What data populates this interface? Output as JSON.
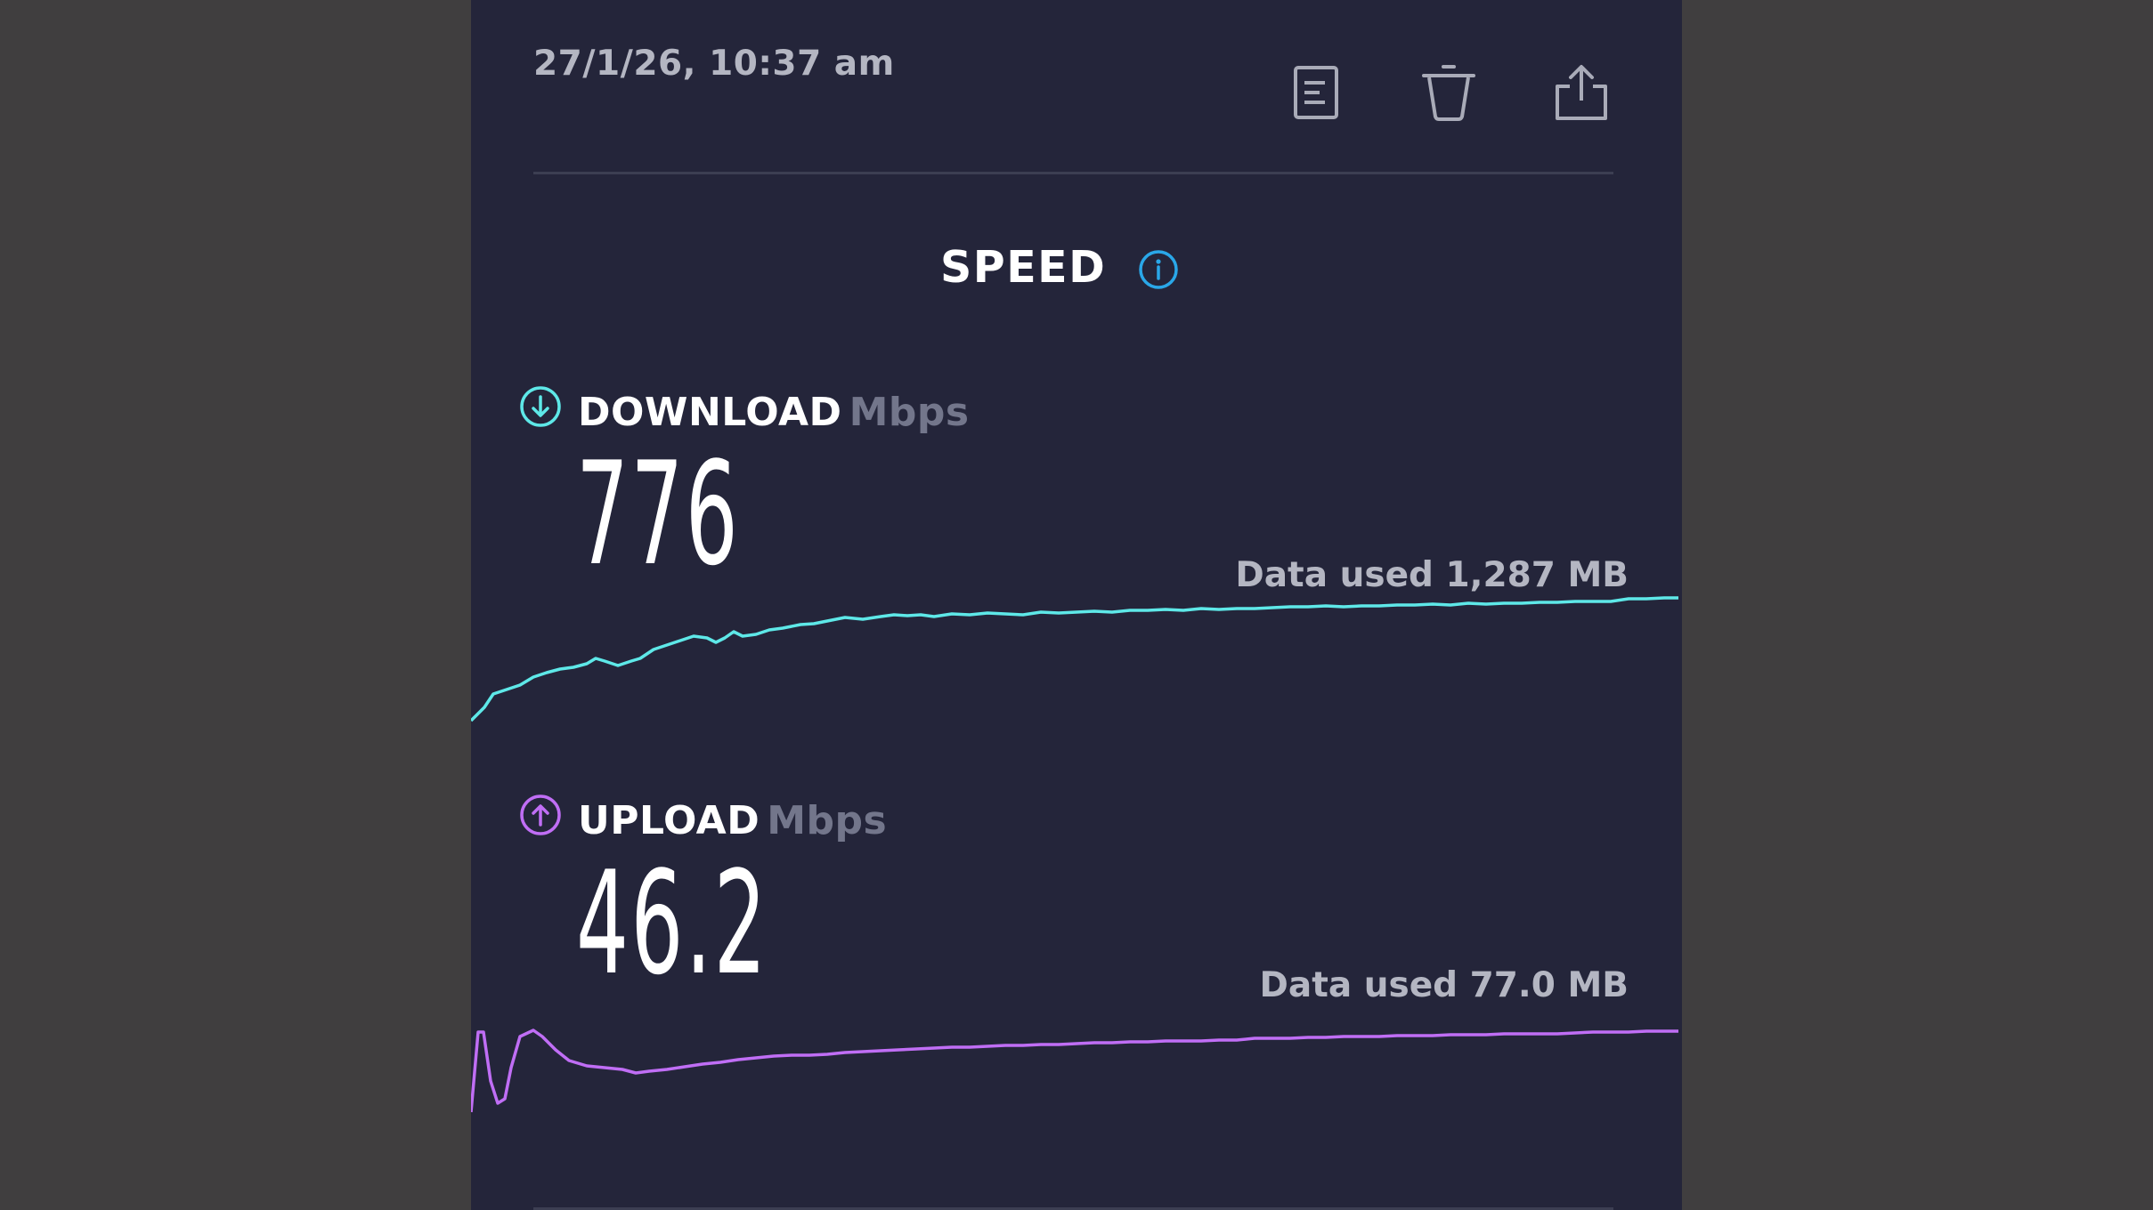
{
  "header": {
    "timestamp": "27/1/26, 10:37 am",
    "actions": [
      {
        "id": "details",
        "icon": "document-icon"
      },
      {
        "id": "delete",
        "icon": "trash-icon"
      },
      {
        "id": "share",
        "icon": "share-icon"
      }
    ]
  },
  "section": {
    "title": "SPEED",
    "info_icon": "info-icon"
  },
  "download": {
    "label": "DOWNLOAD",
    "unit": "Mbps",
    "value": "776",
    "data_used": "Data used 1,287 MB",
    "icon": "download-arrow-icon",
    "color": "#5ee8e8"
  },
  "upload": {
    "label": "UPLOAD",
    "unit": "Mbps",
    "value": "46.2",
    "data_used": "Data used 77.0 MB",
    "icon": "upload-arrow-icon",
    "color": "#c06ef5"
  },
  "colors": {
    "panel_background": "#24253a",
    "page_background": "#403e3f",
    "info_accent": "#2aa7e8",
    "muted_text": "#73768b"
  }
}
